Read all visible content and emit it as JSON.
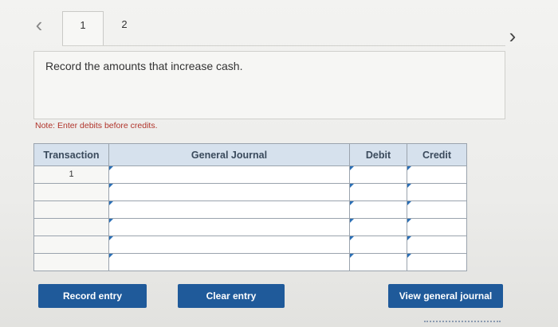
{
  "nav": {
    "prev_icon": "chevron-left-icon",
    "next_icon": "chevron-right-icon"
  },
  "tabs": [
    {
      "label": "1",
      "active": true
    },
    {
      "label": "2",
      "active": false
    }
  ],
  "instruction": "Record the amounts that increase cash.",
  "note": "Note: Enter debits before credits.",
  "journal": {
    "columns": [
      "Transaction",
      "General Journal",
      "Debit",
      "Credit"
    ],
    "rows": [
      {
        "transaction": "1",
        "account": "",
        "debit": "",
        "credit": ""
      },
      {
        "transaction": "",
        "account": "",
        "debit": "",
        "credit": ""
      },
      {
        "transaction": "",
        "account": "",
        "debit": "",
        "credit": ""
      },
      {
        "transaction": "",
        "account": "",
        "debit": "",
        "credit": ""
      },
      {
        "transaction": "",
        "account": "",
        "debit": "",
        "credit": ""
      },
      {
        "transaction": "",
        "account": "",
        "debit": "",
        "credit": ""
      }
    ]
  },
  "buttons": {
    "record": "Record entry",
    "clear": "Clear entry",
    "view": "View general journal"
  },
  "colors": {
    "button_bg": "#1f5a9a",
    "header_bg": "#d6e1ed",
    "note": "#b0332a"
  }
}
